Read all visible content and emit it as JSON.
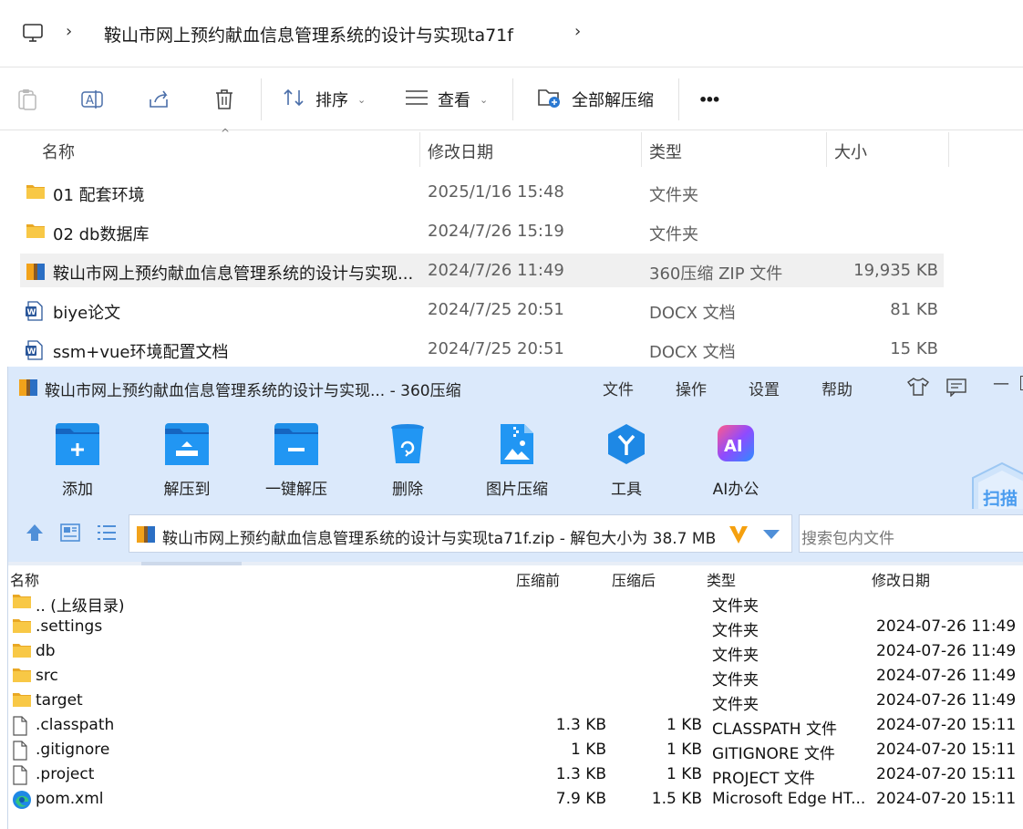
{
  "explorer": {
    "breadcrumb": "鞍山市网上预约献血信息管理系统的设计与实现ta71f",
    "toolbar": {
      "sort_label": "排序",
      "view_label": "查看",
      "extract_all_label": "全部解压缩",
      "more_label": "•••"
    },
    "columns": {
      "name": "名称",
      "date": "修改日期",
      "type": "类型",
      "size": "大小"
    },
    "files": [
      {
        "icon": "folder-icon",
        "name": "01 配套环境",
        "date": "2025/1/16 15:48",
        "type": "文件夹",
        "size": ""
      },
      {
        "icon": "folder-icon",
        "name": "02 db数据库",
        "date": "2024/7/26 15:19",
        "type": "文件夹",
        "size": ""
      },
      {
        "icon": "zip-360-icon",
        "name": "鞍山市网上预约献血信息管理系统的设计与实现...",
        "date": "2024/7/26 11:49",
        "type": "360压缩 ZIP 文件",
        "size": "19,935 KB",
        "selected": true
      },
      {
        "icon": "word-doc-icon",
        "name": "biye论文",
        "date": "2024/7/25 20:51",
        "type": "DOCX 文档",
        "size": "81 KB"
      },
      {
        "icon": "word-doc-icon",
        "name": "ssm+vue环境配置文档",
        "date": "2024/7/25 20:51",
        "type": "DOCX 文档",
        "size": "15 KB"
      }
    ]
  },
  "zip": {
    "title": "鞍山市网上预约献血信息管理系统的设计与实现... - 360压缩",
    "menu": [
      "文件",
      "操作",
      "设置",
      "帮助"
    ],
    "tools": [
      {
        "label": "添加",
        "icon": "add-icon"
      },
      {
        "label": "解压到",
        "icon": "extract-to-icon"
      },
      {
        "label": "一键解压",
        "icon": "one-click-extract-icon"
      },
      {
        "label": "删除",
        "icon": "recycle-icon"
      },
      {
        "label": "图片压缩",
        "icon": "image-compress-icon"
      },
      {
        "label": "工具",
        "icon": "tools-icon"
      },
      {
        "label": "AI办公",
        "icon": "ai-icon"
      }
    ],
    "scan_label": "扫描",
    "path": "鞍山市网上预约献血信息管理系统的设计与实现ta71f.zip - 解包大小为 38.7 MB",
    "search_placeholder": "搜索包内文件",
    "columns": {
      "name": "名称",
      "before": "压缩前",
      "after": "压缩后",
      "type": "类型",
      "date": "修改日期"
    },
    "rows": [
      {
        "icon": "folder-icon",
        "name": ".. (上级目录)",
        "before": "",
        "after": "",
        "type": "文件夹",
        "date": ""
      },
      {
        "icon": "folder-icon",
        "name": ".settings",
        "before": "",
        "after": "",
        "type": "文件夹",
        "date": "2024-07-26 11:49"
      },
      {
        "icon": "folder-icon",
        "name": "db",
        "before": "",
        "after": "",
        "type": "文件夹",
        "date": "2024-07-26 11:49"
      },
      {
        "icon": "folder-icon",
        "name": "src",
        "before": "",
        "after": "",
        "type": "文件夹",
        "date": "2024-07-26 11:49"
      },
      {
        "icon": "folder-icon",
        "name": "target",
        "before": "",
        "after": "",
        "type": "文件夹",
        "date": "2024-07-26 11:49"
      },
      {
        "icon": "file-icon",
        "name": ".classpath",
        "before": "1.3 KB",
        "after": "1 KB",
        "type": "CLASSPATH 文件",
        "date": "2024-07-20 15:11"
      },
      {
        "icon": "file-icon",
        "name": ".gitignore",
        "before": "1 KB",
        "after": "1 KB",
        "type": "GITIGNORE 文件",
        "date": "2024-07-20 15:11"
      },
      {
        "icon": "file-icon",
        "name": ".project",
        "before": "1.3 KB",
        "after": "1 KB",
        "type": "PROJECT 文件",
        "date": "2024-07-20 15:11"
      },
      {
        "icon": "edge-icon",
        "name": "pom.xml",
        "before": "7.9 KB",
        "after": "1.5 KB",
        "type": "Microsoft Edge HT...",
        "date": "2024-07-20 15:11"
      }
    ]
  }
}
